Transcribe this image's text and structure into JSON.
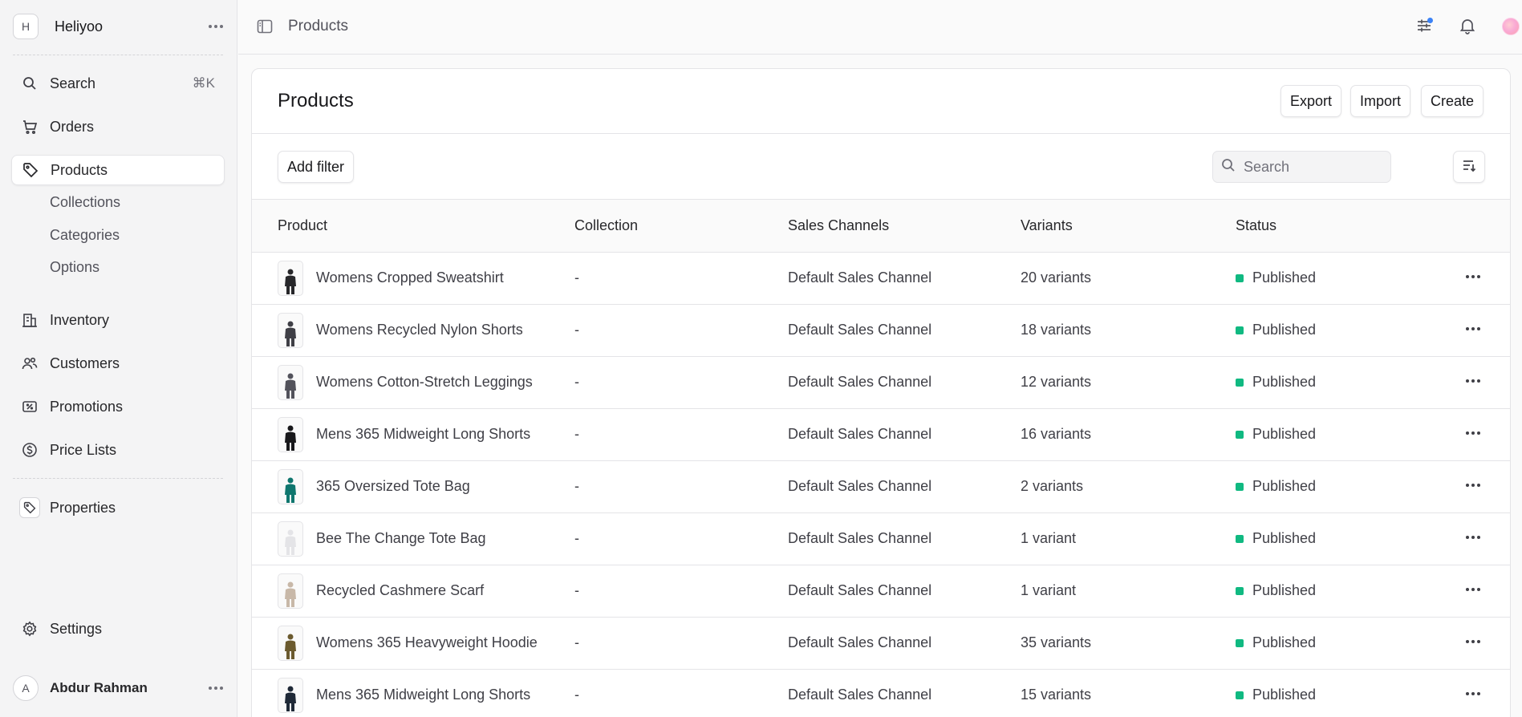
{
  "sidebar": {
    "store": {
      "initial": "H",
      "name": "Heliyoo"
    },
    "search": {
      "label": "Search",
      "shortcut": "⌘K"
    },
    "items": [
      {
        "label": "Orders",
        "icon": "cart-icon"
      },
      {
        "label": "Products",
        "icon": "tag-icon",
        "active": true
      },
      {
        "label": "Inventory",
        "icon": "building-icon"
      },
      {
        "label": "Customers",
        "icon": "users-icon"
      },
      {
        "label": "Promotions",
        "icon": "receipt-percent-icon"
      },
      {
        "label": "Price Lists",
        "icon": "currency-icon"
      }
    ],
    "subitems": [
      "Collections",
      "Categories",
      "Options"
    ],
    "extensions": [
      {
        "label": "Properties",
        "icon": "tag-icon"
      }
    ],
    "settings": {
      "label": "Settings",
      "icon": "gear-icon"
    },
    "user": {
      "initial": "A",
      "name": "Abdur Rahman"
    }
  },
  "topbar": {
    "breadcrumb": "Products",
    "icons": [
      "sidebar-toggle-icon",
      "adjustments-icon",
      "bell-icon",
      "user-avatar"
    ]
  },
  "main": {
    "title": "Products",
    "buttons": {
      "export": "Export",
      "import": "Import",
      "create": "Create"
    },
    "add_filter": "Add filter",
    "search_placeholder": "Search",
    "columns": [
      "Product",
      "Collection",
      "Sales Channels",
      "Variants",
      "Status"
    ],
    "rows": [
      {
        "product": "Womens Cropped Sweatshirt",
        "collection": "-",
        "channel": "Default Sales Channel",
        "variants": "20 variants",
        "status": "Published",
        "thumb_color": "#27272a"
      },
      {
        "product": "Womens Recycled Nylon Shorts",
        "collection": "-",
        "channel": "Default Sales Channel",
        "variants": "18 variants",
        "status": "Published",
        "thumb_color": "#3f3f46"
      },
      {
        "product": "Womens Cotton-Stretch Leggings",
        "collection": "-",
        "channel": "Default Sales Channel",
        "variants": "12 variants",
        "status": "Published",
        "thumb_color": "#52525b"
      },
      {
        "product": "Mens 365 Midweight Long Shorts",
        "collection": "-",
        "channel": "Default Sales Channel",
        "variants": "16 variants",
        "status": "Published",
        "thumb_color": "#18181b"
      },
      {
        "product": "365 Oversized Tote Bag",
        "collection": "-",
        "channel": "Default Sales Channel",
        "variants": "2 variants",
        "status": "Published",
        "thumb_color": "#0f766e"
      },
      {
        "product": "Bee The Change Tote Bag",
        "collection": "-",
        "channel": "Default Sales Channel",
        "variants": "1 variant",
        "status": "Published",
        "thumb_color": "#e4e4e7"
      },
      {
        "product": "Recycled Cashmere Scarf",
        "collection": "-",
        "channel": "Default Sales Channel",
        "variants": "1 variant",
        "status": "Published",
        "thumb_color": "#c8b8a8"
      },
      {
        "product": "Womens 365 Heavyweight Hoodie",
        "collection": "-",
        "channel": "Default Sales Channel",
        "variants": "35 variants",
        "status": "Published",
        "thumb_color": "#6b5a2e"
      },
      {
        "product": "Mens 365 Midweight Long Shorts",
        "collection": "-",
        "channel": "Default Sales Channel",
        "variants": "15 variants",
        "status": "Published",
        "thumb_color": "#1f2937"
      }
    ]
  },
  "colors": {
    "published": "#10b981",
    "accent_dot": "#3b82f6"
  }
}
